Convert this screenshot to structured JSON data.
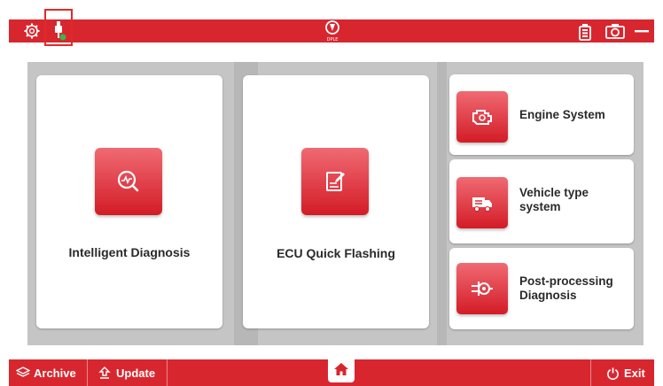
{
  "top_bar": {
    "icons": [
      "gear-icon",
      "usb-connector-icon",
      "brand-logo",
      "battery-icon",
      "camera-icon",
      "minimize-icon"
    ],
    "logo_text": "DPLE",
    "highlight_color": "#e02a2a"
  },
  "main": {
    "intelligent_diagnosis": "Intelligent Diagnosis",
    "ecu_quick_flashing": "ECU Quick Flashing",
    "engine_system": "Engine System",
    "vehicle_type_system_line1": "Vehicle type",
    "vehicle_type_system_line2": "system",
    "post_processing_line1": "Post-processing",
    "post_processing_line2": "Diagnosis"
  },
  "bottom_bar": {
    "archive": "Archive",
    "update": "Update",
    "exit": "Exit"
  },
  "colors": {
    "brand_red": "#d8262f",
    "panel_gray": "#c5c5c5"
  }
}
